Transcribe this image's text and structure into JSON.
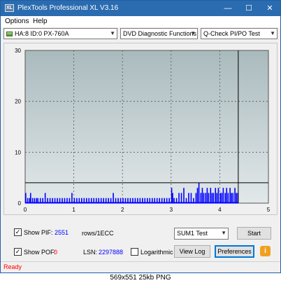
{
  "window": {
    "title": "PlexTools Professional XL V3.16",
    "icon_text": "XL",
    "minimize": "—",
    "maximize": "☐",
    "close": "✕"
  },
  "menu": [
    "Options",
    "Help"
  ],
  "toolbar": {
    "drive": "HA:8 ID:0  PX-760A",
    "function": "DVD Diagnostic Functions",
    "test": "Q-Check PI/PO Test"
  },
  "colors": {
    "title_bar": "#2b6cb0",
    "plot_top": "#a9babd",
    "plot_bottom": "#e2e8ea",
    "bars": "#0000ff",
    "threshold_line": "#000000",
    "status_text": "#ff0000",
    "value_blue": "#0000ff",
    "value_red": "#ff0000"
  },
  "chart_data": {
    "type": "bar",
    "xlim": [
      0,
      5
    ],
    "ylim": [
      0,
      30
    ],
    "x_ticks": [
      "0",
      "1",
      "2",
      "3",
      "4",
      "5"
    ],
    "y_ticks": [
      "0",
      "10",
      "20",
      "30"
    ],
    "grid": true,
    "threshold": 4,
    "data_end_x": 4.38,
    "series": [
      {
        "x": [
          0.0,
          0.04,
          0.08,
          0.1,
          0.14,
          0.18,
          0.22,
          0.25,
          0.3,
          0.35,
          0.4,
          0.45,
          0.5,
          0.55,
          0.6,
          0.65,
          0.7,
          0.75,
          0.8,
          0.85,
          0.9,
          0.95,
          1.0,
          1.05,
          1.1,
          1.15,
          1.2,
          1.25,
          1.3,
          1.35,
          1.4,
          1.45,
          1.5,
          1.55,
          1.6,
          1.65,
          1.7,
          1.75,
          1.8,
          1.85,
          1.9,
          1.95,
          2.0,
          2.05,
          2.1,
          2.15,
          2.2,
          2.25,
          2.3,
          2.35,
          2.4,
          2.45,
          2.5,
          2.55,
          2.6,
          2.65,
          2.7,
          2.75,
          2.8,
          2.85,
          2.9,
          2.95,
          3.0,
          3.02,
          3.05,
          3.1,
          3.15,
          3.2,
          3.25,
          3.3,
          3.35,
          3.4,
          3.45,
          3.5,
          3.53,
          3.56,
          3.6,
          3.63,
          3.66,
          3.7,
          3.73,
          3.76,
          3.8,
          3.83,
          3.86,
          3.9,
          3.93,
          3.96,
          4.0,
          4.03,
          4.06,
          4.1,
          4.13,
          4.16,
          4.2,
          4.23,
          4.26,
          4.3,
          4.33,
          4.36
        ],
        "values": [
          2,
          1,
          1,
          2,
          1,
          1,
          1,
          1,
          1,
          1,
          2,
          1,
          1,
          1,
          1,
          1,
          1,
          1,
          1,
          1,
          1,
          2,
          1,
          1,
          1,
          1,
          1,
          1,
          1,
          1,
          1,
          1,
          1,
          1,
          1,
          1,
          1,
          1,
          2,
          1,
          1,
          1,
          1,
          1,
          1,
          1,
          1,
          1,
          1,
          1,
          1,
          1,
          1,
          1,
          1,
          1,
          1,
          1,
          1,
          1,
          1,
          1,
          3,
          2,
          1,
          1,
          2,
          2,
          3,
          1,
          2,
          2,
          1,
          2,
          3,
          4,
          2,
          3,
          2,
          2,
          3,
          2,
          3,
          2,
          2,
          3,
          2,
          3,
          2,
          2,
          3,
          2,
          3,
          2,
          3,
          2,
          2,
          3,
          2,
          2
        ]
      }
    ]
  },
  "controls": {
    "show_pif_label": "Show PIF:",
    "pif_value": "2551",
    "rows_label": "rows/1ECC",
    "show_pof_label": "Show POF:",
    "pof_value": "0",
    "lsn_label": "LSN:",
    "lsn_value": "2297888",
    "logarithmic_label": "Logarithmic",
    "sum_select": "SUM1 Test",
    "start": "Start",
    "view_log": "View Log",
    "preferences": "Preferences",
    "info": "i"
  },
  "status": "Ready",
  "caption": "569x551  25kb  PNG"
}
